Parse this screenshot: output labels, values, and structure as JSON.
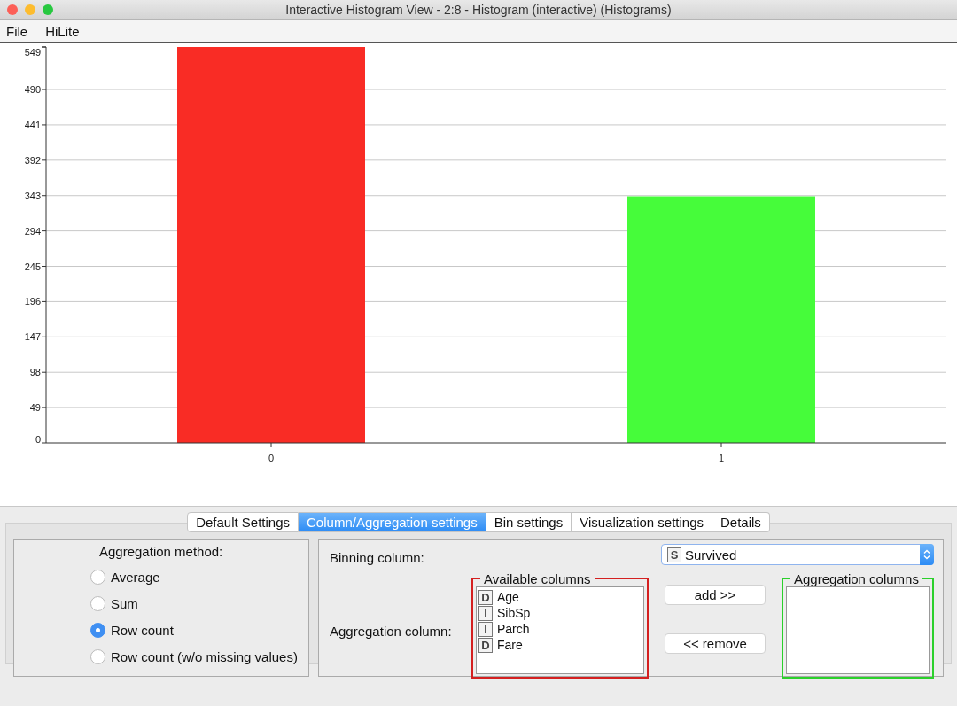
{
  "window": {
    "title": "Interactive Histogram View - 2:8 - Histogram (interactive) (Histograms)"
  },
  "menu": [
    "File",
    "HiLite"
  ],
  "chart": {
    "chart_data": {
      "type": "bar",
      "categories": [
        "0",
        "1"
      ],
      "grid": true,
      "series": [
        {
          "color": "#f92c25",
          "values": [
            549,
            null
          ]
        },
        {
          "color": "#46fc3a",
          "values": [
            null,
            342
          ]
        }
      ],
      "ylim": [
        0,
        549
      ],
      "yticks": [
        0,
        49,
        98,
        147,
        196,
        245,
        294,
        343,
        392,
        441,
        490,
        549
      ]
    }
  },
  "tabs": [
    {
      "label": "Default Settings",
      "selected": false
    },
    {
      "label": "Column/Aggregation settings",
      "selected": true
    },
    {
      "label": "Bin settings",
      "selected": false
    },
    {
      "label": "Visualization settings",
      "selected": false
    },
    {
      "label": "Details",
      "selected": false
    }
  ],
  "aggregation_method": {
    "title": "Aggregation method:",
    "options": [
      {
        "label": "Average",
        "selected": false
      },
      {
        "label": "Sum",
        "selected": false
      },
      {
        "label": "Row count",
        "selected": true
      },
      {
        "label": "Row count (w/o missing values)",
        "selected": false
      }
    ]
  },
  "binning_column": {
    "label": "Binning column:",
    "type_letter": "S",
    "value": "Survived"
  },
  "aggregation_column": {
    "label": "Aggregation column:",
    "available": {
      "title": "Available columns",
      "items": [
        {
          "type_letter": "D",
          "name": "Age"
        },
        {
          "type_letter": "I",
          "name": "SibSp"
        },
        {
          "type_letter": "I",
          "name": "Parch"
        },
        {
          "type_letter": "D",
          "name": "Fare"
        }
      ]
    },
    "buttons": [
      "add >>",
      "<< remove"
    ],
    "selected": {
      "title": "Aggregation columns"
    }
  }
}
